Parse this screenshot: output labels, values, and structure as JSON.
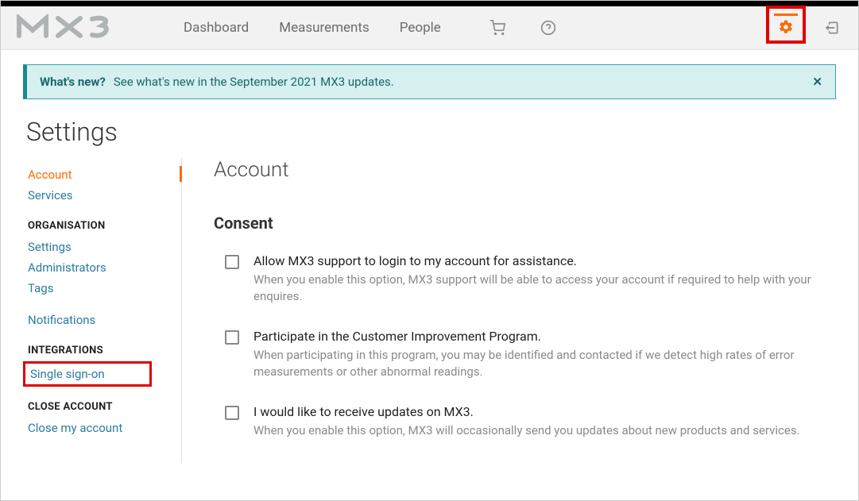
{
  "nav": {
    "dashboard": "Dashboard",
    "measurements": "Measurements",
    "people": "People"
  },
  "banner": {
    "title": "What's new?",
    "text": "See what's new in the September 2021 MX3 updates."
  },
  "page_title": "Settings",
  "sidebar": {
    "account": "Account",
    "services": "Services",
    "org_header": "ORGANISATION",
    "settings": "Settings",
    "administrators": "Administrators",
    "tags": "Tags",
    "notifications": "Notifications",
    "integrations_header": "INTEGRATIONS",
    "sso": "Single sign-on",
    "close_header": "CLOSE ACCOUNT",
    "close_account": "Close my account"
  },
  "main": {
    "heading": "Account",
    "consent_heading": "Consent",
    "options": [
      {
        "label": "Allow MX3 support to login to my account for assistance.",
        "desc": "When you enable this option, MX3 support will be able to access your account if required to help with your enquires."
      },
      {
        "label": "Participate in the Customer Improvement Program.",
        "desc": "When participating in this program, you may be identified and contacted if we detect high rates of error measurements or other abnormal readings."
      },
      {
        "label": "I would like to receive updates on MX3.",
        "desc": "When you enable this option, MX3 will occasionally send you updates about new products and services."
      }
    ]
  }
}
